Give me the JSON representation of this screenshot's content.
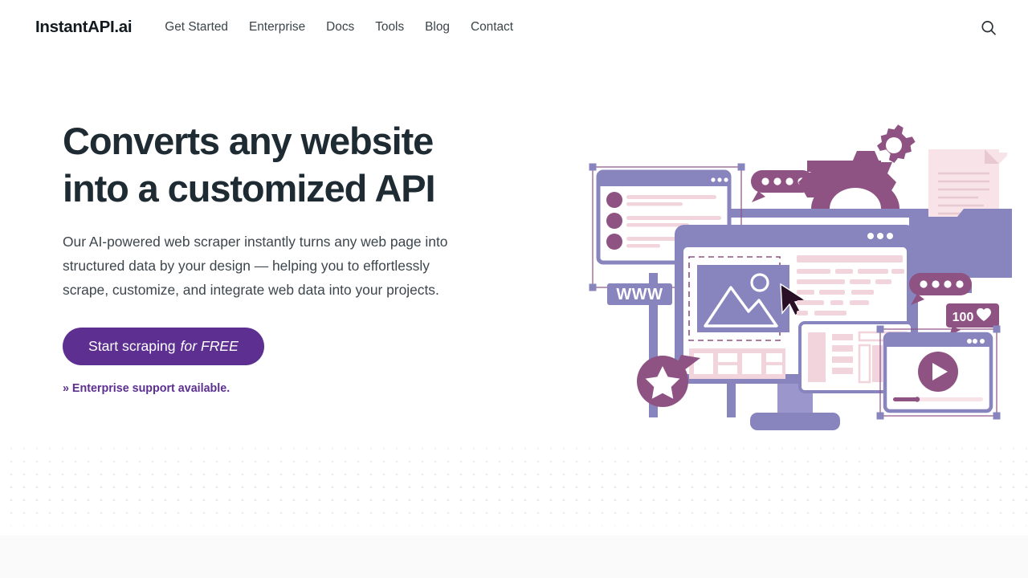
{
  "header": {
    "brand": "InstantAPI.ai",
    "nav": [
      {
        "label": "Get Started"
      },
      {
        "label": "Enterprise"
      },
      {
        "label": "Docs"
      },
      {
        "label": "Tools"
      },
      {
        "label": "Blog"
      },
      {
        "label": "Contact"
      }
    ],
    "search_icon": "search-icon"
  },
  "hero": {
    "headline_line1": "Converts any website",
    "headline_line2": "into a customized API",
    "subcopy": "Our AI-powered web scraper instantly turns any web page into structured data by your design — helping you to effortlessly scrape, customize, and integrate web data into your projects.",
    "cta_label": "Start scraping",
    "cta_label_italic": "for FREE",
    "enterprise_link": "» Enterprise support available."
  },
  "illustration": {
    "www_label": "WWW",
    "likes_count": "100",
    "heart_glyph": "♥",
    "alt": "Illustration of browser windows, monitor, gears, folder, chat bubbles and media player"
  },
  "colors": {
    "headline": "#1e2b33",
    "body_text": "#3c464c",
    "brand_purple": "#5c2f90",
    "periwinkle": "#8884bd",
    "mauve": "#8e5283",
    "pink": "#f2d5dc",
    "light_pink": "#f7e3e8",
    "dot_grid": "#e9e9ea",
    "page_bg": "#ffffff",
    "bottom_band": "#fafafa"
  }
}
